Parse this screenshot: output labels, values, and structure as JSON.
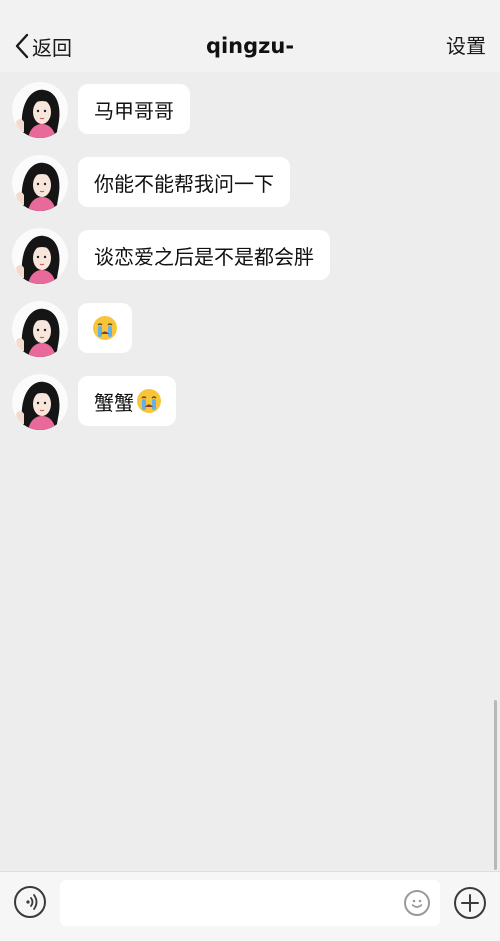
{
  "header": {
    "back_label": "返回",
    "title": "qingzu-",
    "settings_label": "设置"
  },
  "messages": [
    {
      "text": "马甲哥哥",
      "emoji": ""
    },
    {
      "text": "你能不能帮我问一下",
      "emoji": ""
    },
    {
      "text": "谈恋爱之后是不是都会胖",
      "emoji": ""
    },
    {
      "text": "",
      "emoji": "crying-face-emoji"
    },
    {
      "text": "蟹蟹",
      "emoji": "crying-face-emoji"
    }
  ],
  "input": {
    "value": "",
    "placeholder": ""
  },
  "icons": {
    "back": "chevron-left-icon",
    "voice": "voice-icon",
    "emoji": "smiley-icon",
    "more": "plus-icon"
  },
  "colors": {
    "background": "#ededed",
    "bubble": "#ffffff",
    "header": "#f2f2f2"
  }
}
